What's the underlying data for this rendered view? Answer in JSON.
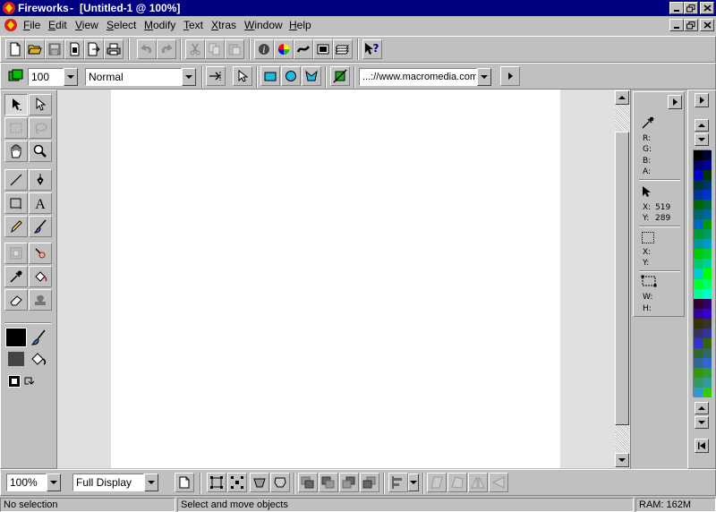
{
  "window": {
    "app_name": "Fireworks",
    "title_sep": " - ",
    "doc_title": "[Untitled-1 @  100%]"
  },
  "menu": [
    "File",
    "Edit",
    "View",
    "Select",
    "Modify",
    "Text",
    "Xtras",
    "Window",
    "Help"
  ],
  "menu_hotkeys": [
    "F",
    "E",
    "V",
    "S",
    "M",
    "T",
    "X",
    "W",
    "H"
  ],
  "toolbar2": {
    "opacity_value": "100",
    "blend_mode": "Normal",
    "url_value": "...://www.macromedia.com"
  },
  "info_panel": {
    "r_label": "R:",
    "g_label": "G:",
    "b_label": "B:",
    "a_label": "A:",
    "x_label": "X:",
    "x_value": "519",
    "y_label": "Y:",
    "y_value": "289",
    "x2_label": "X:",
    "y2_label": "Y:",
    "w_label": "W:",
    "h_label": "H:"
  },
  "bottom_toolbar": {
    "zoom_value": "100%",
    "display_mode": "Full Display"
  },
  "status_bar": {
    "selection": "No selection",
    "hint": "Select and move objects",
    "ram": "RAM: 162M"
  },
  "colors": {
    "titlebar": "#000080",
    "face": "#c0c0c0",
    "canvas": "#ffffff",
    "pasteboard": "#e0e0e0"
  },
  "swatches": [
    "#000000",
    "#000033",
    "#000066",
    "#000099",
    "#0000cc",
    "#003300",
    "#003333",
    "#003366",
    "#003399",
    "#0033cc",
    "#006600",
    "#006633",
    "#006666",
    "#006699",
    "#0066cc",
    "#009900",
    "#009933",
    "#009966",
    "#009999",
    "#0099cc",
    "#00cc00",
    "#00cc33",
    "#00cc66",
    "#00cc99",
    "#00cccc",
    "#00ff00",
    "#00ff33",
    "#00ff66",
    "#00ff99",
    "#00ffcc",
    "#330033",
    "#330066",
    "#330099",
    "#3300cc",
    "#333300",
    "#333333",
    "#333366",
    "#333399",
    "#3333cc",
    "#336600",
    "#336633",
    "#336666",
    "#336699",
    "#3366cc",
    "#339900",
    "#339933",
    "#339966",
    "#339999",
    "#3399cc",
    "#33cc00"
  ]
}
